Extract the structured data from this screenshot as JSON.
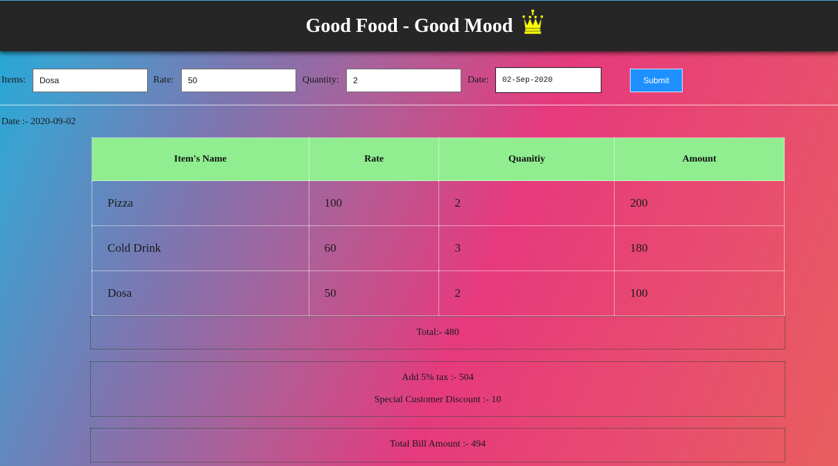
{
  "header": {
    "title": "Good Food - Good Mood",
    "icon": "crown-icon",
    "icon_color": "#ffff00"
  },
  "form": {
    "items_label": "Items:",
    "items_value": "Dosa",
    "rate_label": "Rate:",
    "rate_value": "50",
    "quantity_label": "Quantity:",
    "quantity_value": "2",
    "date_label": "Date:",
    "date_value": "02-Sep-2020",
    "submit_label": "Submit"
  },
  "date_line": "Date :- 2020-09-02",
  "table": {
    "headers": [
      "Item's Name",
      "Rate",
      "Quanitiy",
      "Amount"
    ],
    "rows": [
      [
        "Pizza",
        "100",
        "2",
        "200"
      ],
      [
        "Cold Drink",
        "60",
        "3",
        "180"
      ],
      [
        "Dosa",
        "50",
        "2",
        "100"
      ]
    ],
    "header_color": "#90ee90"
  },
  "summary": {
    "total": "Total:- 480",
    "tax": "Add 5% tax :- 504",
    "discount": "Special Customer Discount :- 10",
    "grand_total": "Total Bill Amount :- 494"
  },
  "colors": {
    "header_bg": "#262626",
    "submit_bg": "#1e90ff"
  }
}
